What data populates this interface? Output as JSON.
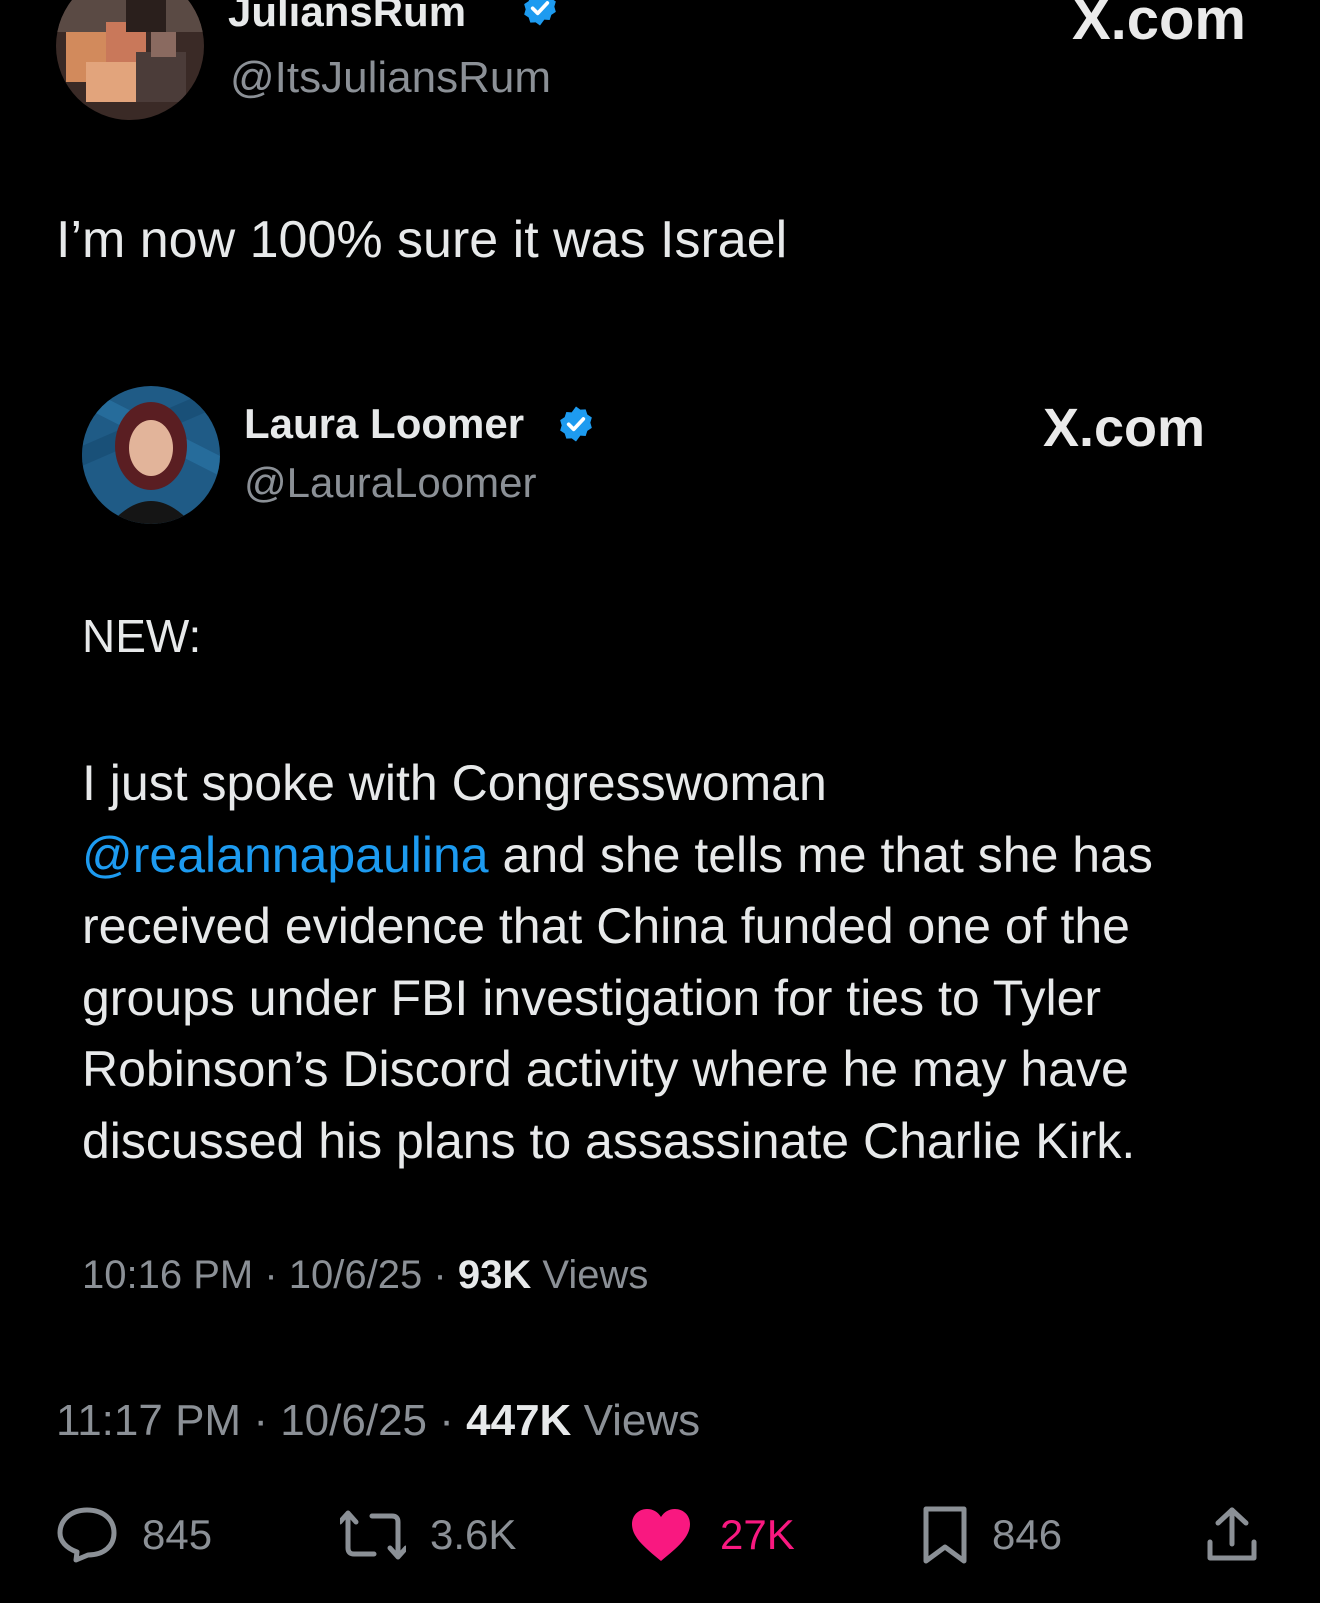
{
  "outer_tweet": {
    "display_name": "JuliansRum",
    "handle": "@ItsJuliansRum",
    "source_label": "X.com",
    "text": "I’m now 100% sure it was Israel",
    "meta": {
      "time": "11:17 PM",
      "separator": "·",
      "date": "10/6/25",
      "views_count": "447K",
      "views_label": "Views"
    }
  },
  "quoted_tweet": {
    "display_name": "Laura Loomer",
    "handle": "@LauraLoomer",
    "source_label": "X.com",
    "lead": "NEW:",
    "body_before_mention": "I just spoke with Congresswoman",
    "mention": "@realannapaulina",
    "body_after_mention": "and she tells me that she has received evidence that China funded one of the groups under FBI investigation for ties to Tyler Robinson’s Discord activity where he may have discussed his plans to assassinate Charlie Kirk.",
    "meta": {
      "time": "10:16 PM",
      "separator": "·",
      "date": "10/6/25",
      "views_count": "93K",
      "views_label": "Views"
    }
  },
  "actions": {
    "reply_count": "845",
    "repost_count": "3.6K",
    "like_count": "27K",
    "bookmark_count": "846"
  },
  "colors": {
    "background": "#000000",
    "text_primary": "#e7e9ea",
    "text_secondary": "#8b9096",
    "mention": "#1d9bf0",
    "verified": "#1d9bf0",
    "like": "#f91880"
  },
  "icons": [
    "verified-badge-icon",
    "reply-icon",
    "repost-icon",
    "like-icon",
    "bookmark-icon",
    "share-icon"
  ]
}
